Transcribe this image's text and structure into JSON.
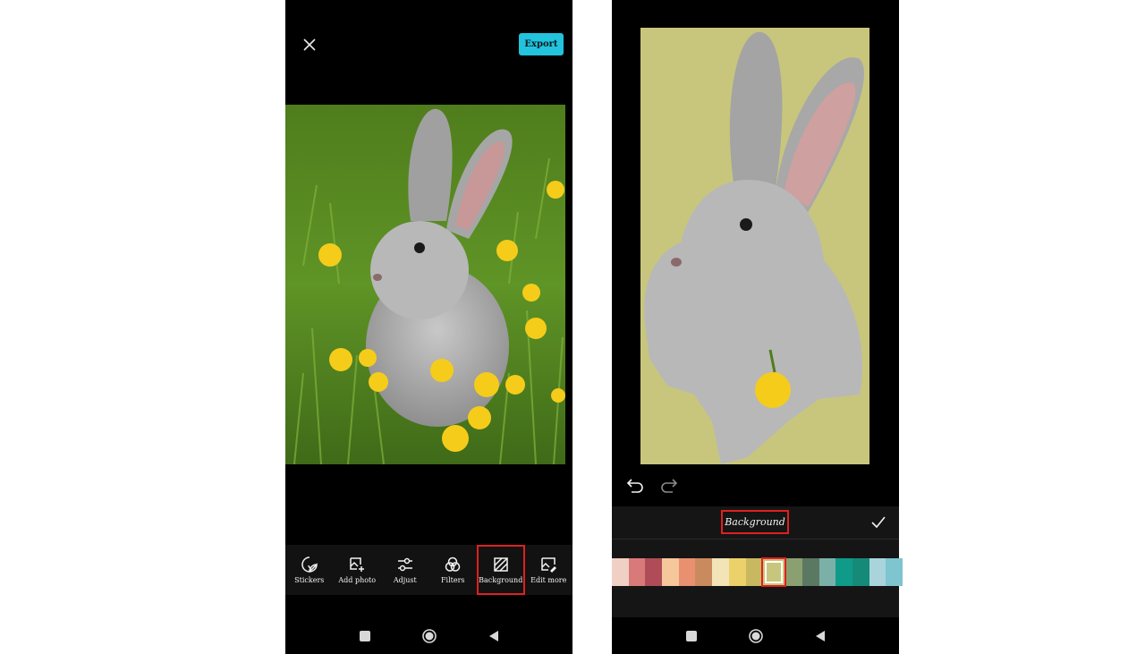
{
  "left_screen": {
    "export_label": "Export",
    "toolbar": [
      {
        "key": "stickers",
        "label": "Stickers",
        "icon": "sticker-icon"
      },
      {
        "key": "add-photo",
        "label": "Add photo",
        "icon": "add-photo-icon"
      },
      {
        "key": "adjust",
        "label": "Adjust",
        "icon": "sliders-icon"
      },
      {
        "key": "filters",
        "label": "Filters",
        "icon": "filters-icon"
      },
      {
        "key": "background",
        "label": "Background",
        "icon": "background-icon",
        "active": true
      },
      {
        "key": "edit-more",
        "label": "Edit more",
        "icon": "edit-image-icon"
      }
    ]
  },
  "right_screen": {
    "panel_title": "Background",
    "background_color": "#c8c67c",
    "swatches": [
      "#f0cfc4",
      "#d97a7a",
      "#b04c58",
      "#f5c79a",
      "#e89070",
      "#c98a5e",
      "#f3e4b8",
      "#ecd06a",
      "#c8b860",
      "#c8c67c",
      "#8aa070",
      "#5a7862",
      "#7bb0a8",
      "#0f9a8a",
      "#168a78",
      "#a9d4dc",
      "#7ec5d0"
    ],
    "selected_swatch": 9
  },
  "colors": {
    "accent_export": "#22c3dc",
    "highlight": "#e02020"
  }
}
